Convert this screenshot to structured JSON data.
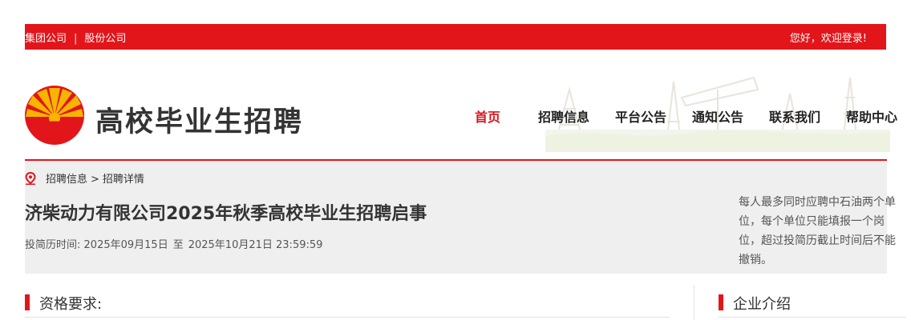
{
  "topbar": {
    "group_link": "集团公司",
    "separator": "|",
    "share_link": "股份公司",
    "welcome": "您好，欢迎登录!"
  },
  "header": {
    "site_title": "高校毕业生招聘",
    "nav": [
      {
        "label": "首页",
        "active": true
      },
      {
        "label": "招聘信息",
        "active": false
      },
      {
        "label": "平台公告",
        "active": false
      },
      {
        "label": "通知公告",
        "active": false
      },
      {
        "label": "联系我们",
        "active": false
      },
      {
        "label": "帮助中心",
        "active": false
      }
    ]
  },
  "breadcrumb": {
    "parent": "招聘信息",
    "arrow": ">",
    "current": "招聘详情"
  },
  "job": {
    "title": "济柴动力有限公司2025年秋季高校毕业生招聘启事",
    "apply_label": "投简历时间:",
    "start": "2025年09月15日",
    "to": "至",
    "end": "2025年10月21日 23:59:59"
  },
  "notice": "每人最多同时应聘中石油两个单位，每个单位只能填报一个岗位，超过投简历截止时间后不能撤销。",
  "sections": {
    "qualification": "资格要求:",
    "company_intro": "企业介绍"
  },
  "colors": {
    "brand_red": "#e2151b",
    "panel_bg": "#efefef",
    "logo_yellow": "#f6b500"
  }
}
